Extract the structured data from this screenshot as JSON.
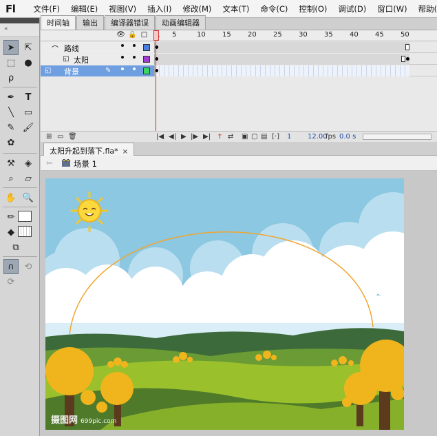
{
  "app": {
    "logo": "Fl"
  },
  "menu": [
    "文件(F)",
    "编辑(E)",
    "视图(V)",
    "插入(I)",
    "修改(M)",
    "文本(T)",
    "命令(C)",
    "控制(O)",
    "调试(D)",
    "窗口(W)",
    "帮助(H)"
  ],
  "timeline": {
    "tabs": [
      "时间轴",
      "输出",
      "编译器错误",
      "动画编辑器"
    ],
    "ruler": [
      "1",
      "5",
      "10",
      "15",
      "20",
      "25",
      "30",
      "35",
      "40",
      "45",
      "50"
    ],
    "layers": [
      {
        "name": "路线",
        "color": "#4a7fe0",
        "type": "guide"
      },
      {
        "name": "太阳",
        "color": "#a23bd6",
        "type": "guided"
      },
      {
        "name": "背景",
        "color": "#3bd65e",
        "type": "normal",
        "selected": true
      }
    ],
    "status": {
      "frame": "1",
      "fps": "12.00",
      "fps_unit": "fps",
      "time": "0.0 s"
    }
  },
  "document": {
    "tab": "太阳升起到落下.fla*",
    "close": "×",
    "scene": "场景 1"
  },
  "stage": {
    "watermark": "摄图网",
    "watermark_url": "699pic.com"
  },
  "colors": {
    "sky": "#8cc8e1",
    "cloud_light": "#ffffff",
    "cloud_blue": "#c6e4f1",
    "hill_dark": "#4f7a3a",
    "hill_green": "#8fbf2b",
    "tree_yellow": "#f0b41c",
    "arc": "#f0a630"
  }
}
